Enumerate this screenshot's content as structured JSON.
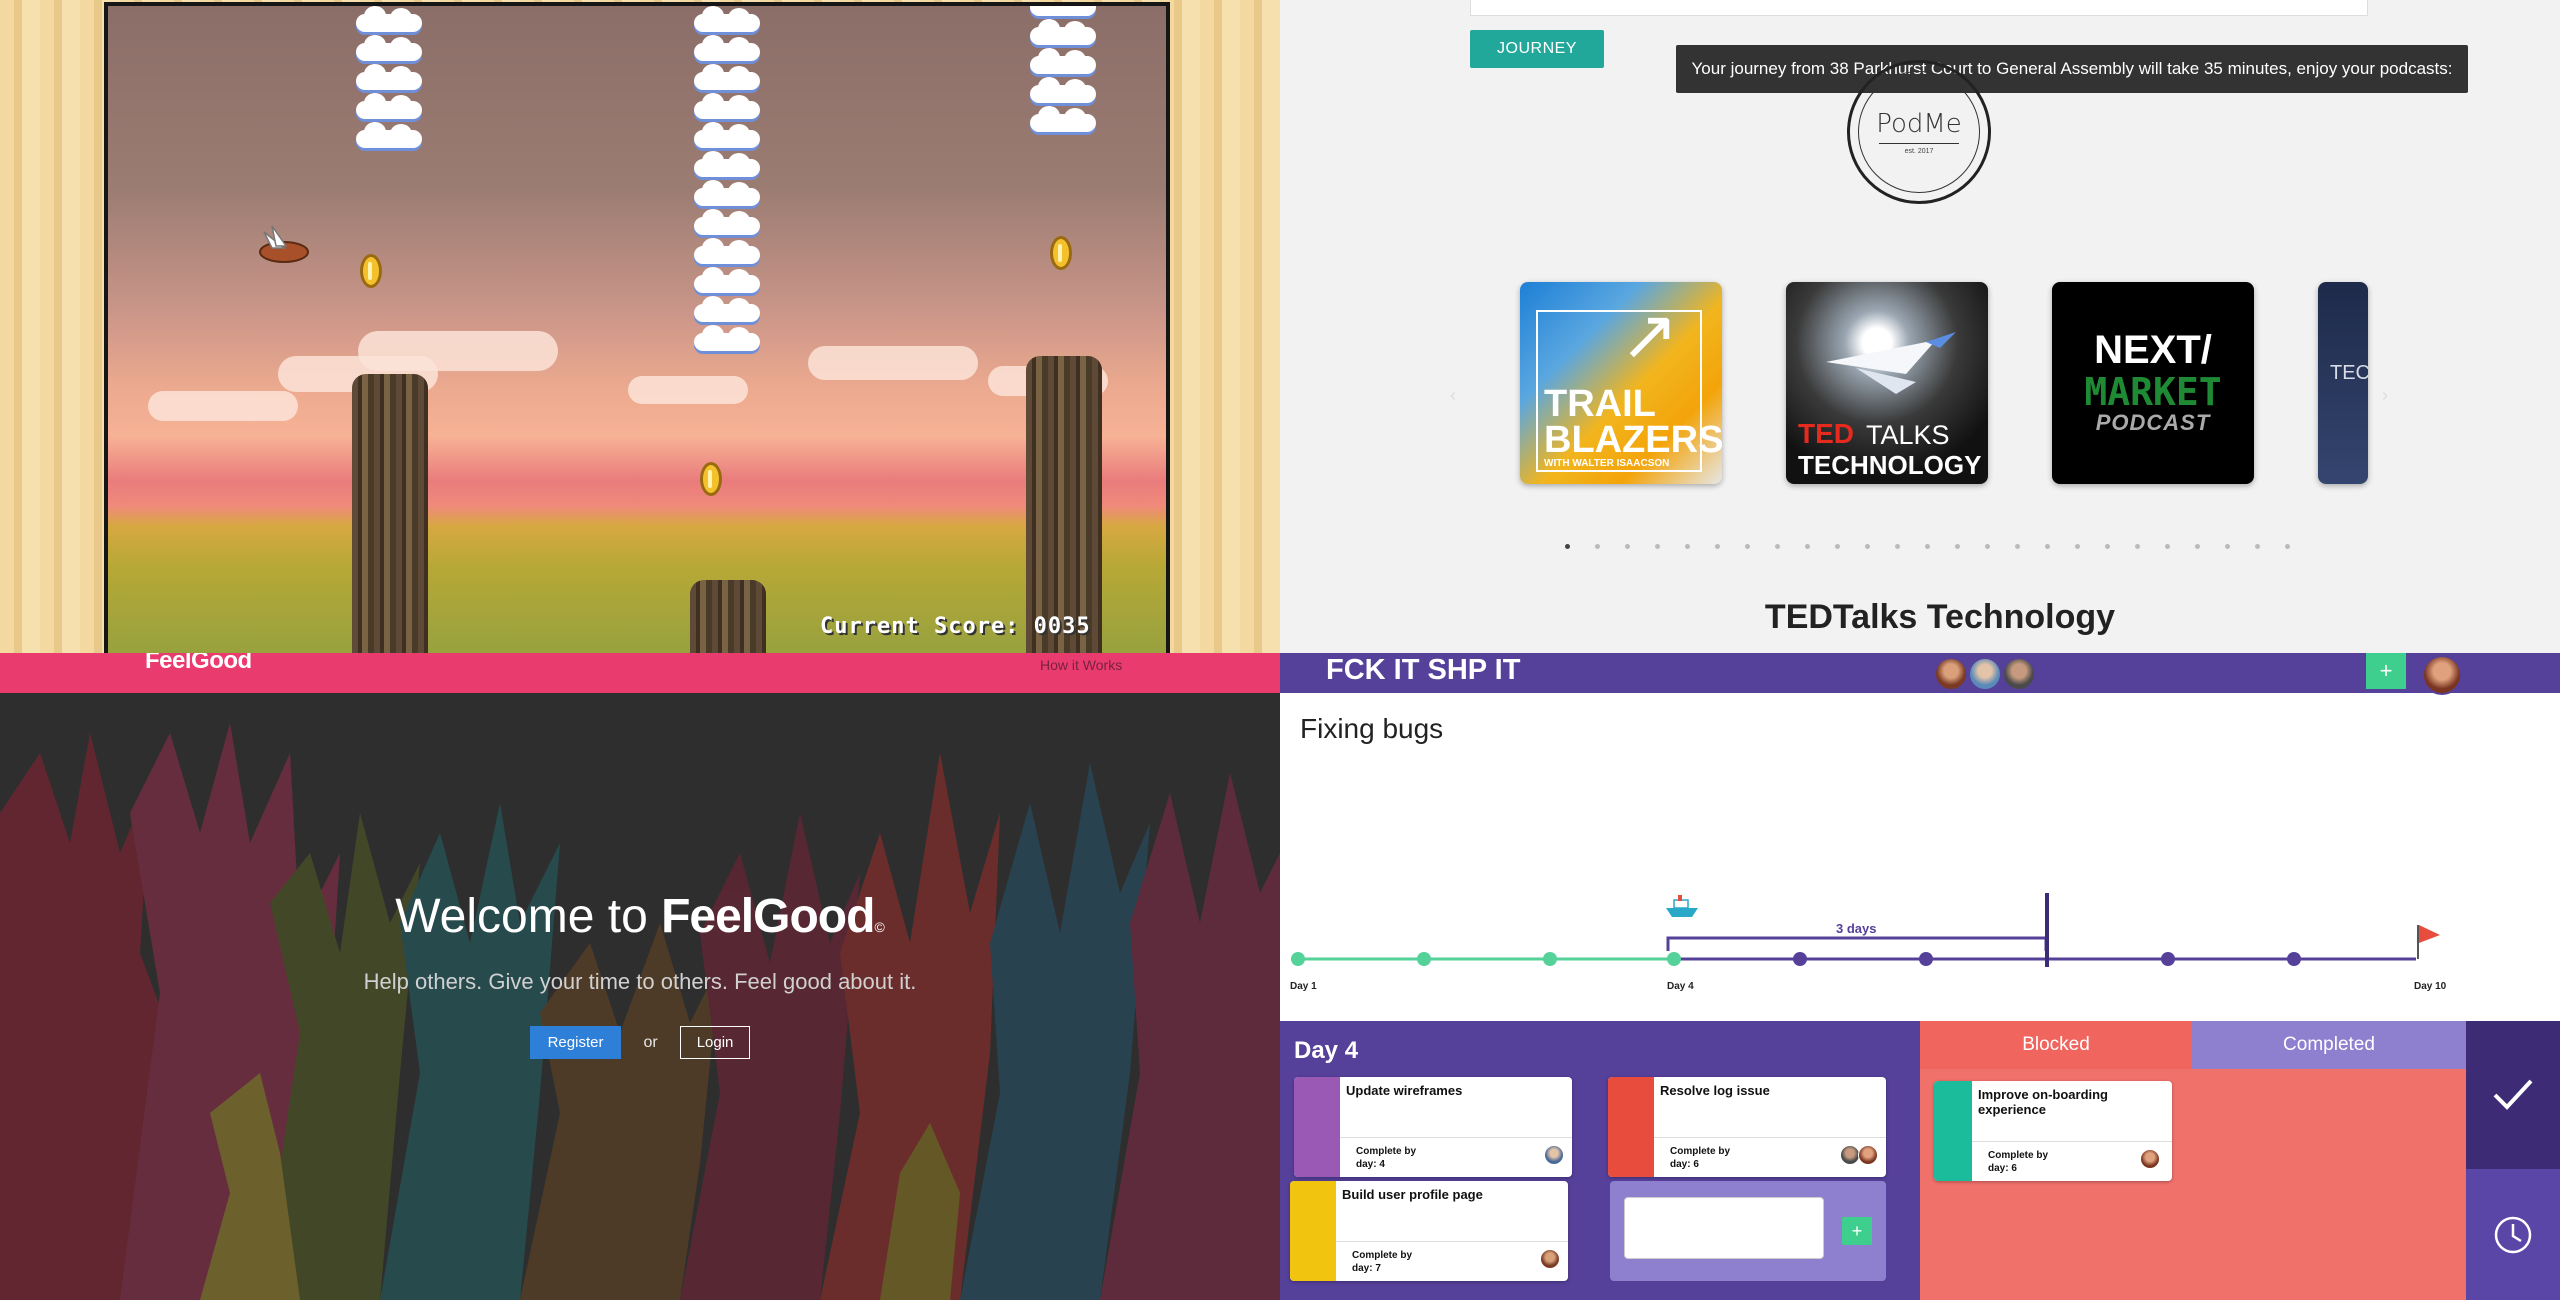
{
  "game": {
    "score_label": "Current Score: 0035"
  },
  "podme": {
    "journey_button": "JOURNEY",
    "journey_message": "Your journey from 38 Parkhurst Court to General Assembly will take 35 minutes, enjoy your podcasts:",
    "logo": {
      "brand": "PodMe",
      "est": "est. 2017"
    },
    "cards": [
      {
        "title_line1": "TRAIL",
        "title_line2": "BLAZERS",
        "subtitle": "WITH WALTER ISAACSON"
      },
      {
        "brand": "TED",
        "brand_suffix": "TALKS",
        "subtitle": "TECHNOLOGY"
      },
      {
        "line1": "NEXT/",
        "line2": "MARKET",
        "line3": "PODCAST"
      },
      {
        "partial": "TEC"
      }
    ],
    "arrows": {
      "prev": "‹",
      "next": "›"
    },
    "dot_count": 25,
    "active_dot": 0,
    "selected_title": "TEDTalks Technology"
  },
  "feelgood": {
    "logo": "FeelGood",
    "nav_link": "How it Works",
    "welcome_prefix": "Welcome to ",
    "welcome_brand": "FeelGood",
    "welcome_mark": "©",
    "tagline": "Help others. Give your time to others. Feel good about it.",
    "register": "Register",
    "or": "or",
    "login": "Login"
  },
  "fckit": {
    "logo": "FCK IT SHP IT",
    "add_button": "+",
    "project_title": "Fixing bugs",
    "timeline": {
      "start_label": "Day 1",
      "current_label": "Day 4",
      "end_label": "Day 10",
      "delay_label": "3 days"
    },
    "day_title": "Day 4",
    "columns": {
      "blocked": "Blocked",
      "completed": "Completed"
    },
    "tasks": [
      {
        "name": "Update wireframes",
        "due": "Complete by day: 4",
        "color": "#9b59b6"
      },
      {
        "name": "Resolve log issue",
        "due": "Complete by day: 6",
        "color": "#e74c3c"
      },
      {
        "name": "Build user profile page",
        "due": "Complete by day: 7",
        "color": "#f1c40f"
      },
      {
        "name": "Improve on-boarding experience",
        "due": "Complete by day: 6",
        "color": "#1abc9c"
      }
    ],
    "new_task_add": "+",
    "colors": {
      "nav": "#55409a",
      "accent": "#3ecf8e",
      "blocked": "#f0706a",
      "completed_head": "#8f7fcf"
    }
  }
}
